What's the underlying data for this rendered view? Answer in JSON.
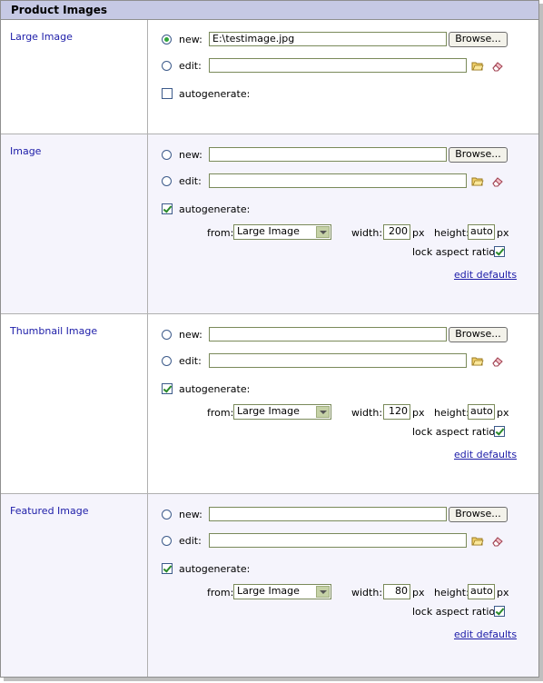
{
  "header": {
    "title": "Product Images"
  },
  "common": {
    "new_label": "new:",
    "edit_label": "edit:",
    "browse_label": "Browse...",
    "autogenerate_label": "autogenerate:",
    "from_label": "from:",
    "width_label": "width:",
    "height_label": "height:",
    "px_label": "px",
    "lock_label": "lock aspect ratio:",
    "edit_defaults_label": "edit defaults"
  },
  "sections": [
    {
      "label": "Large Image",
      "new_selected": true,
      "new_value": "E:\\testimage.jpg",
      "edit_value": "",
      "autogenerate": false
    },
    {
      "label": "Image",
      "new_selected": false,
      "new_value": "",
      "edit_value": "",
      "autogenerate": true,
      "from": "Large Image",
      "width": "200",
      "height": "auto",
      "lock_aspect": true
    },
    {
      "label": "Thumbnail Image",
      "new_selected": false,
      "new_value": "",
      "edit_value": "",
      "autogenerate": true,
      "from": "Large Image",
      "width": "120",
      "height": "auto",
      "lock_aspect": true
    },
    {
      "label": "Featured Image",
      "new_selected": false,
      "new_value": "",
      "edit_value": "",
      "autogenerate": true,
      "from": "Large Image",
      "width": "80",
      "height": "auto",
      "lock_aspect": true
    }
  ]
}
